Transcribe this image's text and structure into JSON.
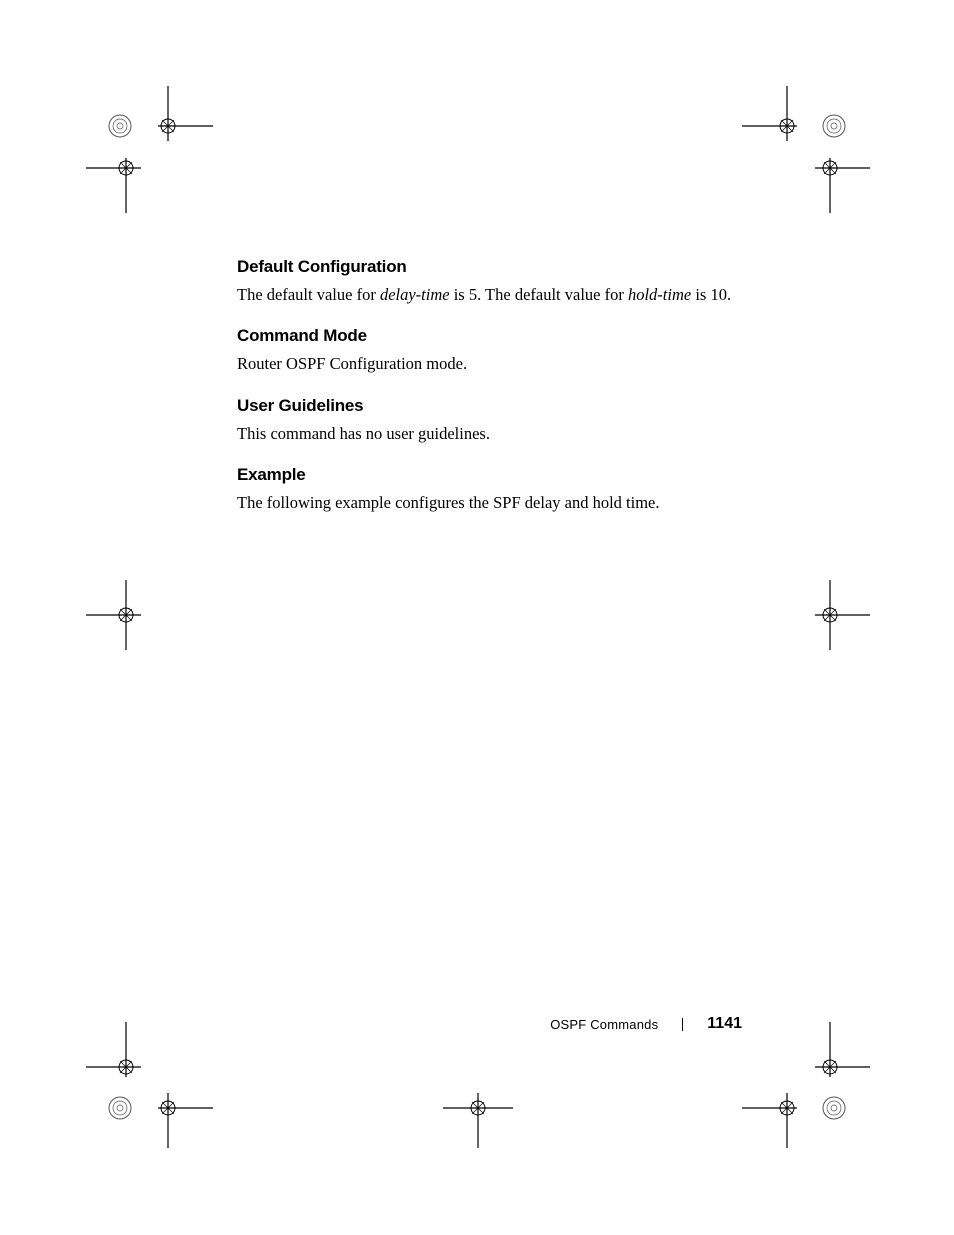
{
  "sections": {
    "default_config": {
      "heading": "Default Configuration",
      "text_pre": "The default value for ",
      "delay_term": "delay-time",
      "text_mid": " is 5. The default value for ",
      "hold_term": "hold-time",
      "text_post": " is 10."
    },
    "command_mode": {
      "heading": "Command Mode",
      "text": "Router OSPF Configuration mode."
    },
    "user_guidelines": {
      "heading": "User Guidelines",
      "text": "This command has no user guidelines."
    },
    "example": {
      "heading": "Example",
      "text": "The following example configures the SPF delay and hold time."
    }
  },
  "footer": {
    "section_title": "OSPF Commands",
    "page_number": "1141"
  }
}
